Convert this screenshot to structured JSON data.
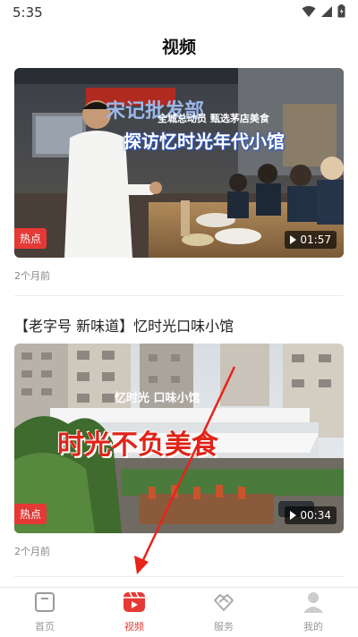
{
  "status_bar": {
    "time": "5:35",
    "icons": [
      "wifi-icon",
      "signal-icon",
      "battery-icon"
    ]
  },
  "header": {
    "title": "视频"
  },
  "feed": {
    "videos": [
      {
        "title": "",
        "thumb_sign": "宋记批发部",
        "thumb_caption_small": "全城总动员 甄选茅店美食",
        "thumb_caption_large": "探访忆时光年代小馆",
        "badge": "热点",
        "duration": "01:57",
        "time_ago": "2个月前"
      },
      {
        "title": "【老字号 新味道】忆时光口味小馆",
        "thumb_sign": "忆时光 口味小馆",
        "thumb_caption_large": "时光不负美食",
        "badge": "热点",
        "duration": "00:34",
        "time_ago": "2个月前"
      }
    ]
  },
  "nav": {
    "items": [
      {
        "label": "首页",
        "icon": "home-icon",
        "active": false
      },
      {
        "label": "视频",
        "icon": "video-icon",
        "active": true
      },
      {
        "label": "服务",
        "icon": "handshake-icon",
        "active": false
      },
      {
        "label": "我的",
        "icon": "person-icon",
        "active": false
      }
    ]
  },
  "colors": {
    "accent": "#e53935",
    "annotation_arrow": "#e8241b",
    "inactive": "#999999"
  }
}
